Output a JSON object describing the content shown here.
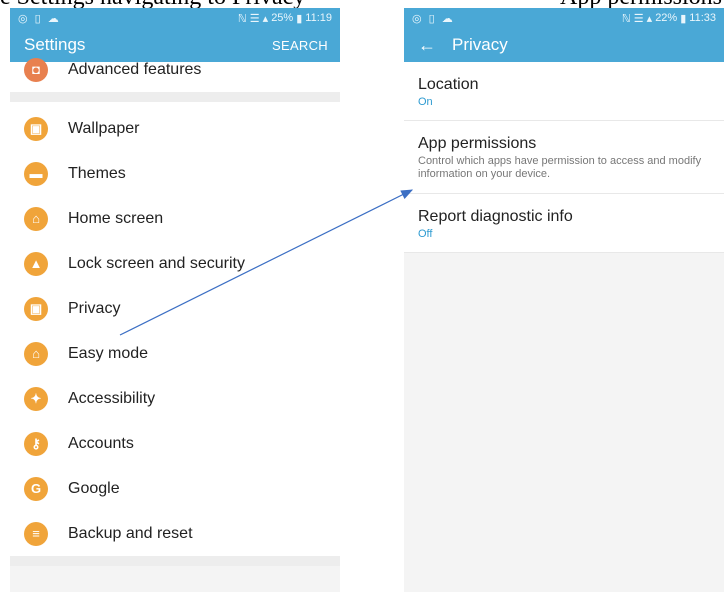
{
  "caption": {
    "left_fragment": "e Settings navigating to Privacy",
    "right_fragment": "App permissions"
  },
  "left_screen": {
    "status": {
      "icons_left": "◎ ▯ ☁",
      "signal": "ℕ ☰ ▴",
      "battery": "25%",
      "time": "11:19"
    },
    "appbar": {
      "title": "Settings",
      "action": "SEARCH"
    },
    "top_item": {
      "label": "Advanced features",
      "color": "#e8804f"
    },
    "items": [
      {
        "label": "Wallpaper",
        "glyph": "▣",
        "color": "#f0a43a"
      },
      {
        "label": "Themes",
        "glyph": "▬",
        "color": "#f0a43a"
      },
      {
        "label": "Home screen",
        "glyph": "⌂",
        "color": "#f0a43a"
      },
      {
        "label": "Lock screen and security",
        "glyph": "▲",
        "color": "#f0a43a"
      },
      {
        "label": "Privacy",
        "glyph": "▣",
        "color": "#f0a43a"
      },
      {
        "label": "Easy mode",
        "glyph": "⌂",
        "color": "#f0a43a"
      },
      {
        "label": "Accessibility",
        "glyph": "✦",
        "color": "#f0a43a"
      },
      {
        "label": "Accounts",
        "glyph": "⚷",
        "color": "#f0a43a"
      },
      {
        "label": "Google",
        "glyph": "G",
        "color": "#f0a43a"
      },
      {
        "label": "Backup and reset",
        "glyph": "≡",
        "color": "#f0a43a"
      }
    ]
  },
  "right_screen": {
    "status": {
      "icons_left": "◎ ▯ ☁",
      "signal": "ℕ ☰ ▴",
      "battery": "22%",
      "time": "11:33"
    },
    "appbar": {
      "title": "Privacy",
      "back": "←"
    },
    "items": [
      {
        "title": "Location",
        "sub": "On"
      },
      {
        "title": "App permissions",
        "desc": "Control which apps have permission to access and modify information on your device."
      },
      {
        "title": "Report diagnostic info",
        "sub": "Off"
      }
    ]
  },
  "colors": {
    "appbar": "#4aa8d6",
    "accent_text": "#2e9bd1",
    "icon_orange": "#f0a43a",
    "arrow": "#3c6fc4"
  }
}
